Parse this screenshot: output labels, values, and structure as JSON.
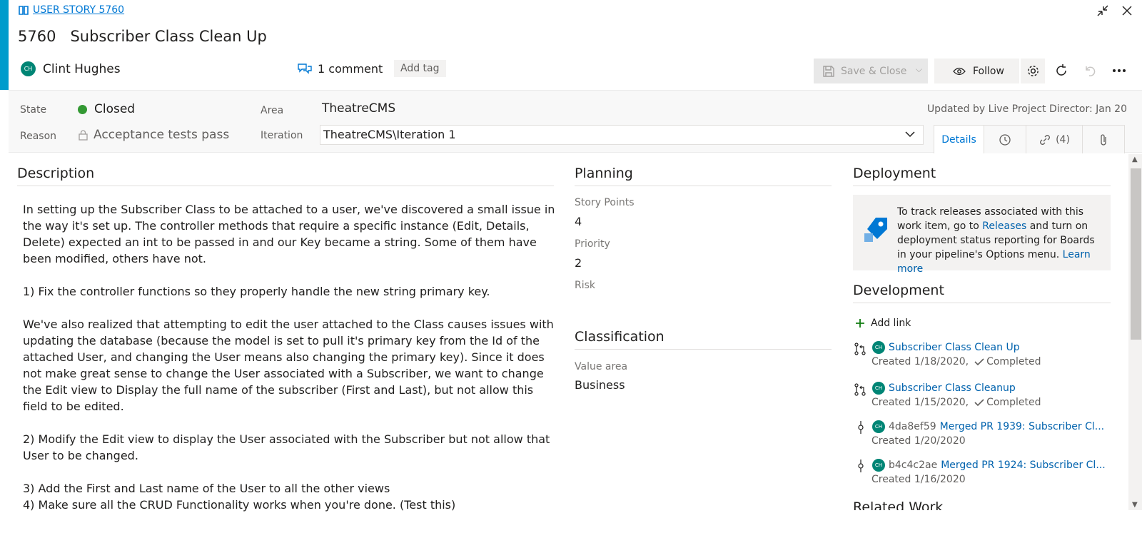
{
  "header": {
    "type_label": "USER STORY 5760",
    "id": "5760",
    "title": "Subscriber Class Clean Up",
    "owner_name": "Clint Hughes",
    "owner_initials": "CH",
    "comments_label": "1 comment",
    "add_tag_label": "Add tag",
    "save_close_label": "Save & Close",
    "follow_label": "Follow"
  },
  "fields": {
    "state_label": "State",
    "state_value": "Closed",
    "reason_label": "Reason",
    "reason_value": "Acceptance tests pass",
    "area_label": "Area",
    "area_value": "TheatreCMS",
    "iteration_label": "Iteration",
    "iteration_value": "TheatreCMS\\Iteration 1",
    "updated_text": "Updated by Live Project Director: Jan 20"
  },
  "tabs": {
    "details_label": "Details",
    "links_label": "(4)"
  },
  "description": {
    "heading": "Description",
    "paragraphs": [
      "In setting up the Subscriber Class to be attached to a user, we've discovered a small issue in the way it's set up. The controller methods that require a specific instance (Edit, Details, Delete) expected an int to be passed in and our Key became a string. Some of them have been modified, others have not.",
      "1) Fix the controller functions so they properly handle the new string primary key.",
      "We've also realized that attempting to edit the user attached to the Class causes issues with updating the database (because the model is set to pull it's primary key from the Id of the attached User, and changing the User means also changing the primary key). Since it does not make great sense to change the User associated with a Subscriber, we want to change the Edit view to Display the full name of the subscriber (First and Last), but not allow this field to be edited.",
      "2) Modify the Edit view to display the User associated with the Subscriber but not allow that User to be changed.",
      "3) Add the First and Last name of the User to all the other views",
      "4) Make sure all the CRUD Functionality works when you're done. (Test this)"
    ]
  },
  "planning": {
    "heading": "Planning",
    "story_points_label": "Story Points",
    "story_points_value": "4",
    "priority_label": "Priority",
    "priority_value": "2",
    "risk_label": "Risk"
  },
  "classification": {
    "heading": "Classification",
    "value_area_label": "Value area",
    "value_area_value": "Business"
  },
  "deployment": {
    "heading": "Deployment",
    "text_1": "To track releases associated with this work item, go to ",
    "releases_link": "Releases",
    "text_2": " and turn on deployment status reporting for Boards in your pipeline's Options menu. ",
    "learn_more_link": "Learn more"
  },
  "development": {
    "heading": "Development",
    "add_link_label": "Add link",
    "items": [
      {
        "kind": "pr",
        "prefix": "",
        "title": "Subscriber Class Clean Up",
        "created": "Created 1/18/2020,",
        "status": "Completed"
      },
      {
        "kind": "pr",
        "prefix": "",
        "title": "Subscriber Class Cleanup",
        "created": "Created 1/15/2020,",
        "status": "Completed"
      },
      {
        "kind": "commit",
        "prefix": "4da8ef59",
        "title": "Merged PR 1939: Subscriber Cl...",
        "created": "Created 1/20/2020",
        "status": ""
      },
      {
        "kind": "commit",
        "prefix": "b4c4c2ae",
        "title": "Merged PR 1924: Subscriber Cl...",
        "created": "Created 1/16/2020",
        "status": ""
      }
    ],
    "related_heading": "Related Work"
  }
}
